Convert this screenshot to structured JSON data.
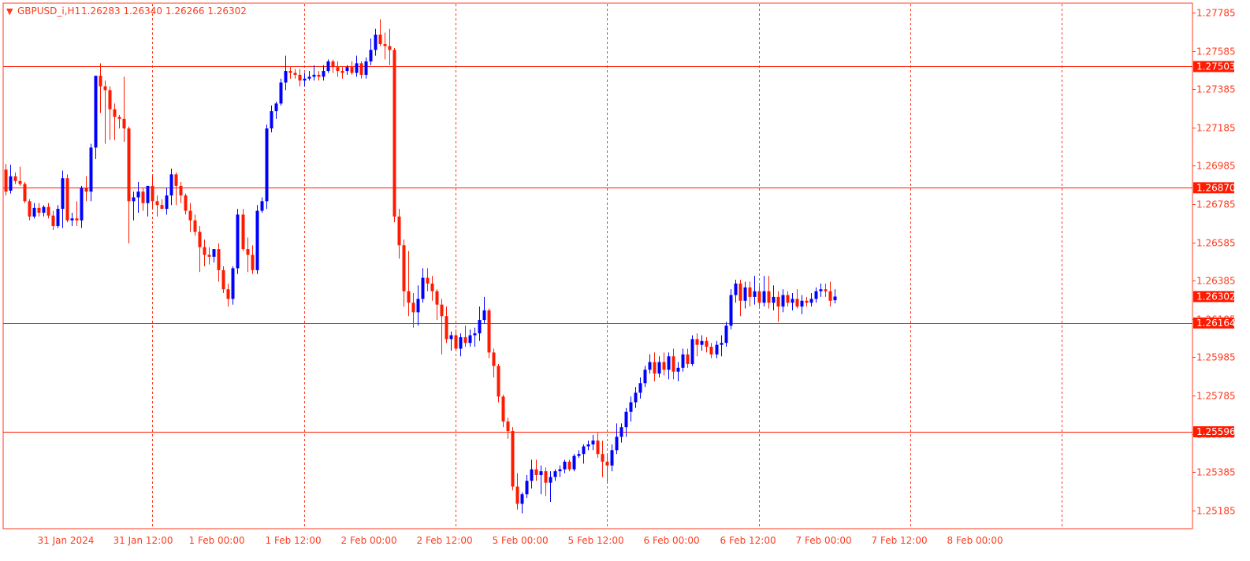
{
  "header": {
    "arrow": "▼",
    "symbol": "GBPUSD_i,H1",
    "ohlc": "1.26283 1.26340 1.26266 1.26302"
  },
  "colors": {
    "frame": "#FF3B1F",
    "grid": "#FF3B1F",
    "text": "#FF3B1F",
    "bull": "#0000FF",
    "bear": "#FF1A00",
    "level_line": "#FF1A00",
    "label_bg": "#FF1A00",
    "label_text": "#FFFFFF"
  },
  "chart_data": {
    "type": "candlestick",
    "title": "GBPUSD_i,H1",
    "timeframe": "H1",
    "ylim": [
      1.2509,
      1.2783
    ],
    "grid": "vertical dashed",
    "y_ticks": [
      "1.27785",
      "1.27585",
      "1.27385",
      "1.27185",
      "1.26985",
      "1.26785",
      "1.26585",
      "1.26385",
      "1.26185",
      "1.25985",
      "1.25785",
      "1.25585",
      "1.25385",
      "1.25185"
    ],
    "x_ticks": [
      "31 Jan 2024",
      "31 Jan 12:00",
      "1 Feb 00:00",
      "1 Feb 12:00",
      "2 Feb 00:00",
      "2 Feb 12:00",
      "5 Feb 00:00",
      "5 Feb 12:00",
      "6 Feb 00:00",
      "6 Feb 12:00",
      "7 Feb 00:00",
      "7 Feb 12:00",
      "8 Feb 00:00"
    ],
    "levels": [
      "1.27503",
      "1.26870",
      "1.26164",
      "1.25596"
    ],
    "current_price": "1.26302",
    "ohlc": [
      [
        1.26965,
        1.26995,
        1.2683,
        1.2685
      ],
      [
        1.26855,
        1.2699,
        1.2684,
        1.2693
      ],
      [
        1.2693,
        1.2695,
        1.2689,
        1.26905
      ],
      [
        1.26905,
        1.2698,
        1.2688,
        1.2689
      ],
      [
        1.2689,
        1.269,
        1.2679,
        1.268
      ],
      [
        1.268,
        1.2681,
        1.267,
        1.2672
      ],
      [
        1.2672,
        1.2679,
        1.2671,
        1.26765
      ],
      [
        1.26765,
        1.2679,
        1.2672,
        1.2674
      ],
      [
        1.2674,
        1.2678,
        1.2672,
        1.2677
      ],
      [
        1.2677,
        1.2679,
        1.2671,
        1.26725
      ],
      [
        1.26725,
        1.2675,
        1.2665,
        1.2667
      ],
      [
        1.2667,
        1.2678,
        1.2666,
        1.2676
      ],
      [
        1.2676,
        1.2696,
        1.2666,
        1.2692
      ],
      [
        1.2692,
        1.2694,
        1.2669,
        1.267
      ],
      [
        1.267,
        1.2674,
        1.2667,
        1.2671
      ],
      [
        1.2671,
        1.268,
        1.2667,
        1.267
      ],
      [
        1.267,
        1.2688,
        1.2666,
        1.2687
      ],
      [
        1.2687,
        1.2693,
        1.268,
        1.2685
      ],
      [
        1.2685,
        1.271,
        1.268,
        1.2708
      ],
      [
        1.2708,
        1.2731,
        1.2702,
        1.27455
      ],
      [
        1.27455,
        1.2752,
        1.2726,
        1.274
      ],
      [
        1.274,
        1.2743,
        1.271,
        1.2738
      ],
      [
        1.2738,
        1.274,
        1.2712,
        1.2728
      ],
      [
        1.2728,
        1.2731,
        1.2712,
        1.2724
      ],
      [
        1.2724,
        1.2725,
        1.2718,
        1.2723
      ],
      [
        1.2723,
        1.2745,
        1.2711,
        1.2718
      ],
      [
        1.2718,
        1.2719,
        1.2658,
        1.268
      ],
      [
        1.268,
        1.2685,
        1.267,
        1.2682
      ],
      [
        1.2682,
        1.269,
        1.2674,
        1.2685
      ],
      [
        1.2685,
        1.2687,
        1.2675,
        1.2679
      ],
      [
        1.2679,
        1.2688,
        1.2672,
        1.2688
      ],
      [
        1.2688,
        1.2693,
        1.2676,
        1.268
      ],
      [
        1.268,
        1.2683,
        1.2672,
        1.2678
      ],
      [
        1.2678,
        1.2681,
        1.2676,
        1.2676
      ],
      [
        1.2676,
        1.2687,
        1.2673,
        1.2683
      ],
      [
        1.2683,
        1.2697,
        1.2678,
        1.2694
      ],
      [
        1.2694,
        1.2695,
        1.2678,
        1.2688
      ],
      [
        1.2688,
        1.269,
        1.2679,
        1.2683
      ],
      [
        1.2683,
        1.2684,
        1.2673,
        1.2675
      ],
      [
        1.2675,
        1.2679,
        1.2664,
        1.267
      ],
      [
        1.267,
        1.2673,
        1.2662,
        1.2664
      ],
      [
        1.2664,
        1.2667,
        1.2643,
        1.2656
      ],
      [
        1.2656,
        1.266,
        1.2646,
        1.2652
      ],
      [
        1.2652,
        1.2656,
        1.2647,
        1.2651
      ],
      [
        1.2651,
        1.2655,
        1.2648,
        1.2655
      ],
      [
        1.2655,
        1.2658,
        1.2638,
        1.2644
      ],
      [
        1.2644,
        1.2646,
        1.2632,
        1.2634
      ],
      [
        1.2634,
        1.2637,
        1.2625,
        1.2629
      ],
      [
        1.2629,
        1.2646,
        1.2626,
        1.2645
      ],
      [
        1.2645,
        1.2676,
        1.2642,
        1.2673
      ],
      [
        1.2673,
        1.2676,
        1.2654,
        1.2655
      ],
      [
        1.2655,
        1.2661,
        1.2643,
        1.2652
      ],
      [
        1.2652,
        1.2657,
        1.2642,
        1.2644
      ],
      [
        1.2644,
        1.2678,
        1.2642,
        1.2675
      ],
      [
        1.2675,
        1.2682,
        1.2674,
        1.268
      ],
      [
        1.268,
        1.272,
        1.2676,
        1.2718
      ],
      [
        1.2718,
        1.273,
        1.2716,
        1.2727
      ],
      [
        1.2727,
        1.2732,
        1.2723,
        1.2731
      ],
      [
        1.2731,
        1.2744,
        1.273,
        1.2742
      ],
      [
        1.2742,
        1.2756,
        1.2738,
        1.2748
      ],
      [
        1.2748,
        1.275,
        1.2744,
        1.2747
      ],
      [
        1.2747,
        1.2749,
        1.2744,
        1.2746
      ],
      [
        1.2746,
        1.2749,
        1.274,
        1.2743
      ],
      [
        1.2743,
        1.2747,
        1.274,
        1.2744
      ],
      [
        1.2744,
        1.2748,
        1.2743,
        1.2745
      ],
      [
        1.2745,
        1.2751,
        1.2743,
        1.2746
      ],
      [
        1.2746,
        1.2748,
        1.2743,
        1.2745
      ],
      [
        1.2745,
        1.2751,
        1.2743,
        1.2748
      ],
      [
        1.2748,
        1.2754,
        1.2747,
        1.2753
      ],
      [
        1.2753,
        1.2754,
        1.2747,
        1.275
      ],
      [
        1.275,
        1.2753,
        1.2745,
        1.2748
      ],
      [
        1.2748,
        1.275,
        1.2744,
        1.2747
      ],
      [
        1.2748,
        1.2751,
        1.2746,
        1.275
      ],
      [
        1.275,
        1.2753,
        1.2746,
        1.2747
      ],
      [
        1.2747,
        1.2756,
        1.2745,
        1.2752
      ],
      [
        1.2752,
        1.2753,
        1.2744,
        1.2746
      ],
      [
        1.2746,
        1.2755,
        1.2744,
        1.2753
      ],
      [
        1.2753,
        1.2765,
        1.2751,
        1.2759
      ],
      [
        1.2759,
        1.277,
        1.2756,
        1.2767
      ],
      [
        1.2767,
        1.2775,
        1.2761,
        1.2762
      ],
      [
        1.2762,
        1.2768,
        1.2754,
        1.2761
      ],
      [
        1.2761,
        1.277,
        1.2751,
        1.2759
      ],
      [
        1.2759,
        1.276,
        1.2669,
        1.2672
      ],
      [
        1.2672,
        1.2676,
        1.265,
        1.2657
      ],
      [
        1.2657,
        1.266,
        1.2625,
        1.2633
      ],
      [
        1.2633,
        1.2654,
        1.262,
        1.2627
      ],
      [
        1.2627,
        1.2632,
        1.2614,
        1.2622
      ],
      [
        1.2622,
        1.2636,
        1.2615,
        1.2629
      ],
      [
        1.2629,
        1.2645,
        1.2627,
        1.264
      ],
      [
        1.264,
        1.2645,
        1.2633,
        1.2637
      ],
      [
        1.2637,
        1.2641,
        1.2628,
        1.2633
      ],
      [
        1.2633,
        1.2634,
        1.2618,
        1.2626
      ],
      [
        1.2626,
        1.2629,
        1.26,
        1.262
      ],
      [
        1.262,
        1.2625,
        1.2606,
        1.2608
      ],
      [
        1.2608,
        1.2612,
        1.2602,
        1.261
      ],
      [
        1.261,
        1.2613,
        1.2602,
        1.2603
      ],
      [
        1.2603,
        1.2611,
        1.2599,
        1.2609
      ],
      [
        1.2609,
        1.2615,
        1.2604,
        1.2606
      ],
      [
        1.2606,
        1.2613,
        1.2604,
        1.261
      ],
      [
        1.261,
        1.2614,
        1.2604,
        1.2611
      ],
      [
        1.2611,
        1.2625,
        1.2607,
        1.2618
      ],
      [
        1.2618,
        1.263,
        1.2616,
        1.2623
      ],
      [
        1.2623,
        1.2624,
        1.2598,
        1.2601
      ],
      [
        1.2601,
        1.2603,
        1.2588,
        1.2594
      ],
      [
        1.2594,
        1.2595,
        1.2575,
        1.2578
      ],
      [
        1.2578,
        1.2579,
        1.2562,
        1.2565
      ],
      [
        1.2565,
        1.2567,
        1.2556,
        1.256
      ],
      [
        1.256,
        1.2562,
        1.2529,
        1.2531
      ],
      [
        1.2531,
        1.2538,
        1.2519,
        1.2522
      ],
      [
        1.2522,
        1.2528,
        1.2517,
        1.2527
      ],
      [
        1.2527,
        1.2537,
        1.2525,
        1.2534
      ],
      [
        1.2534,
        1.2545,
        1.253,
        1.254
      ],
      [
        1.254,
        1.2545,
        1.2534,
        1.2537
      ],
      [
        1.2537,
        1.2542,
        1.2527,
        1.2539
      ],
      [
        1.2539,
        1.2541,
        1.2526,
        1.2533
      ],
      [
        1.2533,
        1.2539,
        1.2523,
        1.2536
      ],
      [
        1.2536,
        1.254,
        1.2534,
        1.2539
      ],
      [
        1.2539,
        1.2542,
        1.2536,
        1.254
      ],
      [
        1.254,
        1.2545,
        1.2538,
        1.2544
      ],
      [
        1.2544,
        1.2545,
        1.2539,
        1.254
      ],
      [
        1.254,
        1.2548,
        1.2539,
        1.2547
      ],
      [
        1.2547,
        1.255,
        1.2546,
        1.2548
      ],
      [
        1.2548,
        1.2553,
        1.2543,
        1.2552
      ],
      [
        1.2552,
        1.2555,
        1.255,
        1.2553
      ],
      [
        1.2553,
        1.2558,
        1.255,
        1.2555
      ],
      [
        1.2555,
        1.2559,
        1.2546,
        1.2548
      ],
      [
        1.2548,
        1.2555,
        1.2536,
        1.2544
      ],
      [
        1.2544,
        1.2548,
        1.2533,
        1.2542
      ],
      [
        1.2542,
        1.2553,
        1.2539,
        1.255
      ],
      [
        1.255,
        1.2564,
        1.2548,
        1.2557
      ],
      [
        1.2557,
        1.2564,
        1.2554,
        1.2562
      ],
      [
        1.2562,
        1.2572,
        1.2557,
        1.257
      ],
      [
        1.257,
        1.2578,
        1.2565,
        1.2575
      ],
      [
        1.2575,
        1.2583,
        1.2572,
        1.258
      ],
      [
        1.258,
        1.2588,
        1.2577,
        1.2585
      ],
      [
        1.2585,
        1.2594,
        1.2583,
        1.2592
      ],
      [
        1.2592,
        1.26,
        1.259,
        1.2596
      ],
      [
        1.2596,
        1.2601,
        1.2586,
        1.259
      ],
      [
        1.259,
        1.2599,
        1.2588,
        1.2596
      ],
      [
        1.2596,
        1.2601,
        1.2589,
        1.2592
      ],
      [
        1.2592,
        1.2601,
        1.2587,
        1.2599
      ],
      [
        1.2599,
        1.2603,
        1.2587,
        1.2591
      ],
      [
        1.2591,
        1.2596,
        1.2586,
        1.2593
      ],
      [
        1.2593,
        1.2603,
        1.2591,
        1.26
      ],
      [
        1.26,
        1.2603,
        1.2593,
        1.2595
      ],
      [
        1.2595,
        1.261,
        1.2594,
        1.2608
      ],
      [
        1.2608,
        1.2611,
        1.2599,
        1.2605
      ],
      [
        1.2605,
        1.261,
        1.2602,
        1.2607
      ],
      [
        1.2607,
        1.2609,
        1.2601,
        1.2604
      ],
      [
        1.2604,
        1.2606,
        1.2598,
        1.26
      ],
      [
        1.26,
        1.2607,
        1.2598,
        1.2605
      ],
      [
        1.2605,
        1.261,
        1.2599,
        1.2606
      ],
      [
        1.2606,
        1.2617,
        1.2604,
        1.2615
      ],
      [
        1.2615,
        1.2634,
        1.2613,
        1.2631
      ],
      [
        1.2631,
        1.2639,
        1.2627,
        1.2637
      ],
      [
        1.2637,
        1.2639,
        1.262,
        1.2628
      ],
      [
        1.2628,
        1.2638,
        1.2624,
        1.2635
      ],
      [
        1.2635,
        1.2638,
        1.2625,
        1.263
      ],
      [
        1.263,
        1.2641,
        1.2626,
        1.2633
      ],
      [
        1.2633,
        1.2636,
        1.2625,
        1.2627
      ],
      [
        1.2627,
        1.2641,
        1.2625,
        1.2633
      ],
      [
        1.2633,
        1.2641,
        1.2624,
        1.2627
      ],
      [
        1.2627,
        1.2636,
        1.2623,
        1.263
      ],
      [
        1.263,
        1.2633,
        1.2617,
        1.2625
      ],
      [
        1.2625,
        1.2634,
        1.2622,
        1.2631
      ],
      [
        1.2631,
        1.2633,
        1.2625,
        1.2627
      ],
      [
        1.2627,
        1.2632,
        1.2623,
        1.2629
      ],
      [
        1.2629,
        1.2634,
        1.2624,
        1.2625
      ],
      [
        1.2625,
        1.2631,
        1.2621,
        1.2628
      ],
      [
        1.2628,
        1.263,
        1.2625,
        1.2627
      ],
      [
        1.2627,
        1.2632,
        1.2625,
        1.2629
      ],
      [
        1.2629,
        1.2635,
        1.2627,
        1.2633
      ],
      [
        1.2633,
        1.2637,
        1.263,
        1.2634
      ],
      [
        1.2634,
        1.2637,
        1.263,
        1.2633
      ],
      [
        1.2633,
        1.2638,
        1.2625,
        1.2628
      ],
      [
        1.26283,
        1.2634,
        1.26266,
        1.26302
      ]
    ]
  }
}
